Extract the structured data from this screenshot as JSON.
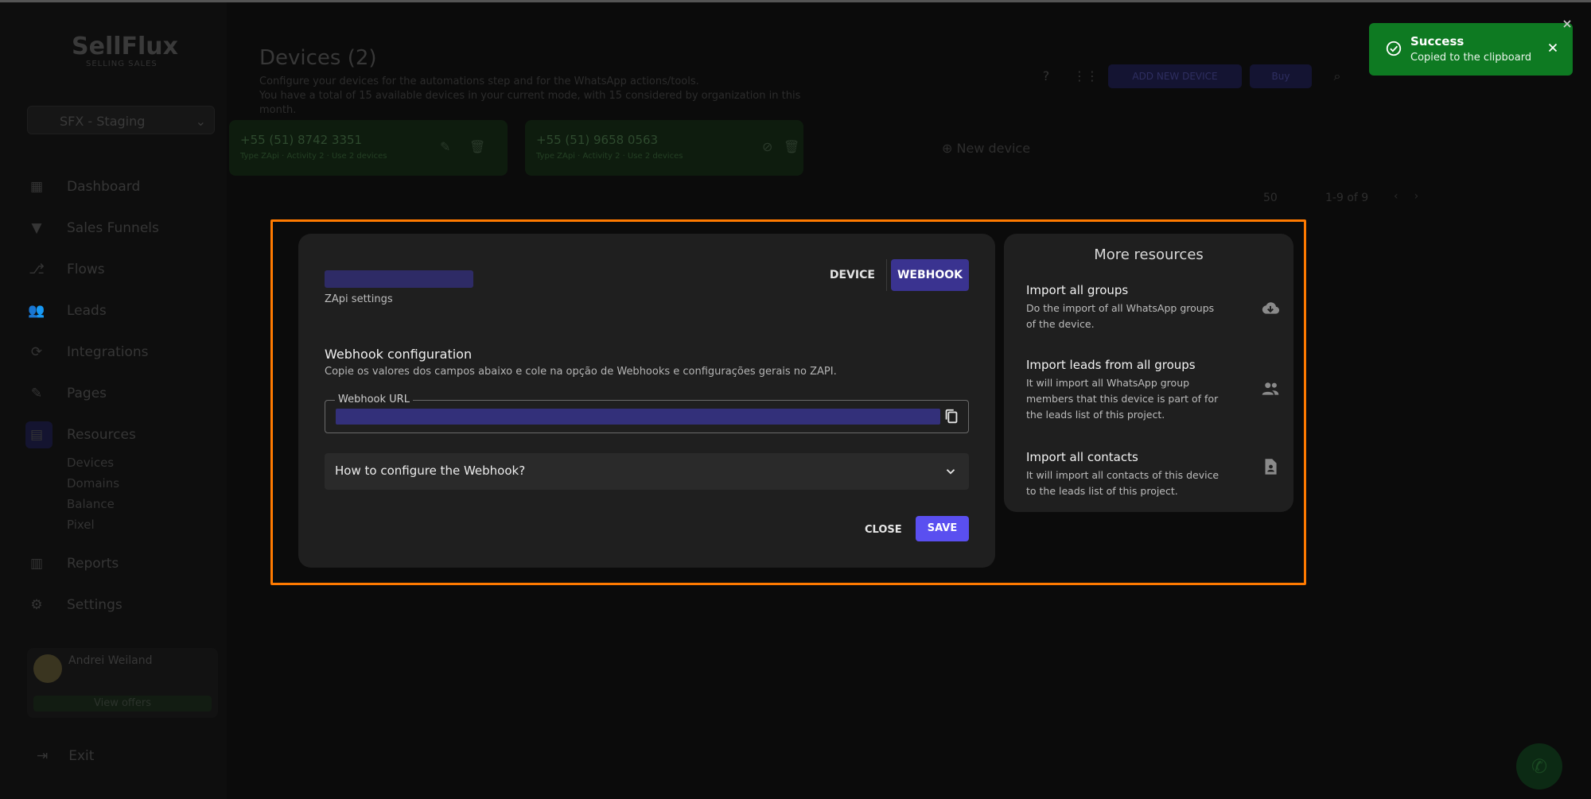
{
  "app": {
    "logo": "SellFlux",
    "logo_sub": "SELLING SALES",
    "project": "SFX - Staging"
  },
  "sidebar": {
    "items": [
      {
        "label": "Dashboard",
        "icon": "dashboard-icon"
      },
      {
        "label": "Sales Funnels",
        "icon": "funnel-icon"
      },
      {
        "label": "Flows",
        "icon": "flows-icon"
      },
      {
        "label": "Leads",
        "icon": "leads-icon"
      },
      {
        "label": "Integrations",
        "icon": "integrations-icon"
      },
      {
        "label": "Pages",
        "icon": "pages-icon"
      },
      {
        "label": "Resources",
        "icon": "resources-icon"
      },
      {
        "label": "Reports",
        "icon": "reports-icon"
      },
      {
        "label": "Settings",
        "icon": "gear-icon"
      }
    ],
    "resources_sub": [
      "Devices",
      "Domains",
      "Balance",
      "Pixel"
    ],
    "user_name": "Andrei Weiland",
    "view_offers": "View offers",
    "exit": "Exit"
  },
  "page": {
    "title": "Devices (2)",
    "desc_line1": "Configure your devices for the automations step and for the WhatsApp actions/tools.",
    "desc_line2": "You have a total of 15 available devices in your current mode, with 15 considered by organization in this month.",
    "add_device": "ADD NEW DEVICE",
    "buy": "Buy",
    "devices": [
      {
        "number": "+55 (51) 8742 3351",
        "meta": "Type ZApi · Activity 2 · Use 2 devices"
      },
      {
        "number": "+55 (51) 9658 0563",
        "meta": "Type ZApi · Activity 2 · Use 2 devices"
      }
    ],
    "new_device": "New device",
    "per_page": "50",
    "range": "1-9 of 9"
  },
  "modal": {
    "subtitle": "ZApi settings",
    "tabs": {
      "device": "DEVICE",
      "webhook": "WEBHOOK"
    },
    "webhook_title": "Webhook configuration",
    "webhook_desc": "Copie os valores dos campos abaixo e cole na opção de Webhooks e configurações gerais no ZAPI.",
    "url_label": "Webhook URL",
    "accordion_label": "How to configure the Webhook?",
    "close": "CLOSE",
    "save": "SAVE"
  },
  "resources": {
    "title": "More resources",
    "items": [
      {
        "title": "Import all groups",
        "desc": "Do the import of all WhatsApp groups of the device.",
        "icon": "cloud-download-icon"
      },
      {
        "title": "Import leads from all groups",
        "desc": "It will import all WhatsApp group members that this device is part of for the leads list of this project.",
        "icon": "people-icon"
      },
      {
        "title": "Import all contacts",
        "desc": "It will import all contacts of this device to the leads list of this project.",
        "icon": "contact-file-icon"
      }
    ]
  },
  "toast": {
    "title": "Success",
    "message": "Copied to the clipboard"
  },
  "colors": {
    "accent": "#5a4ff0",
    "highlight": "#ff7a00",
    "toast_bg": "#0e7a22"
  }
}
